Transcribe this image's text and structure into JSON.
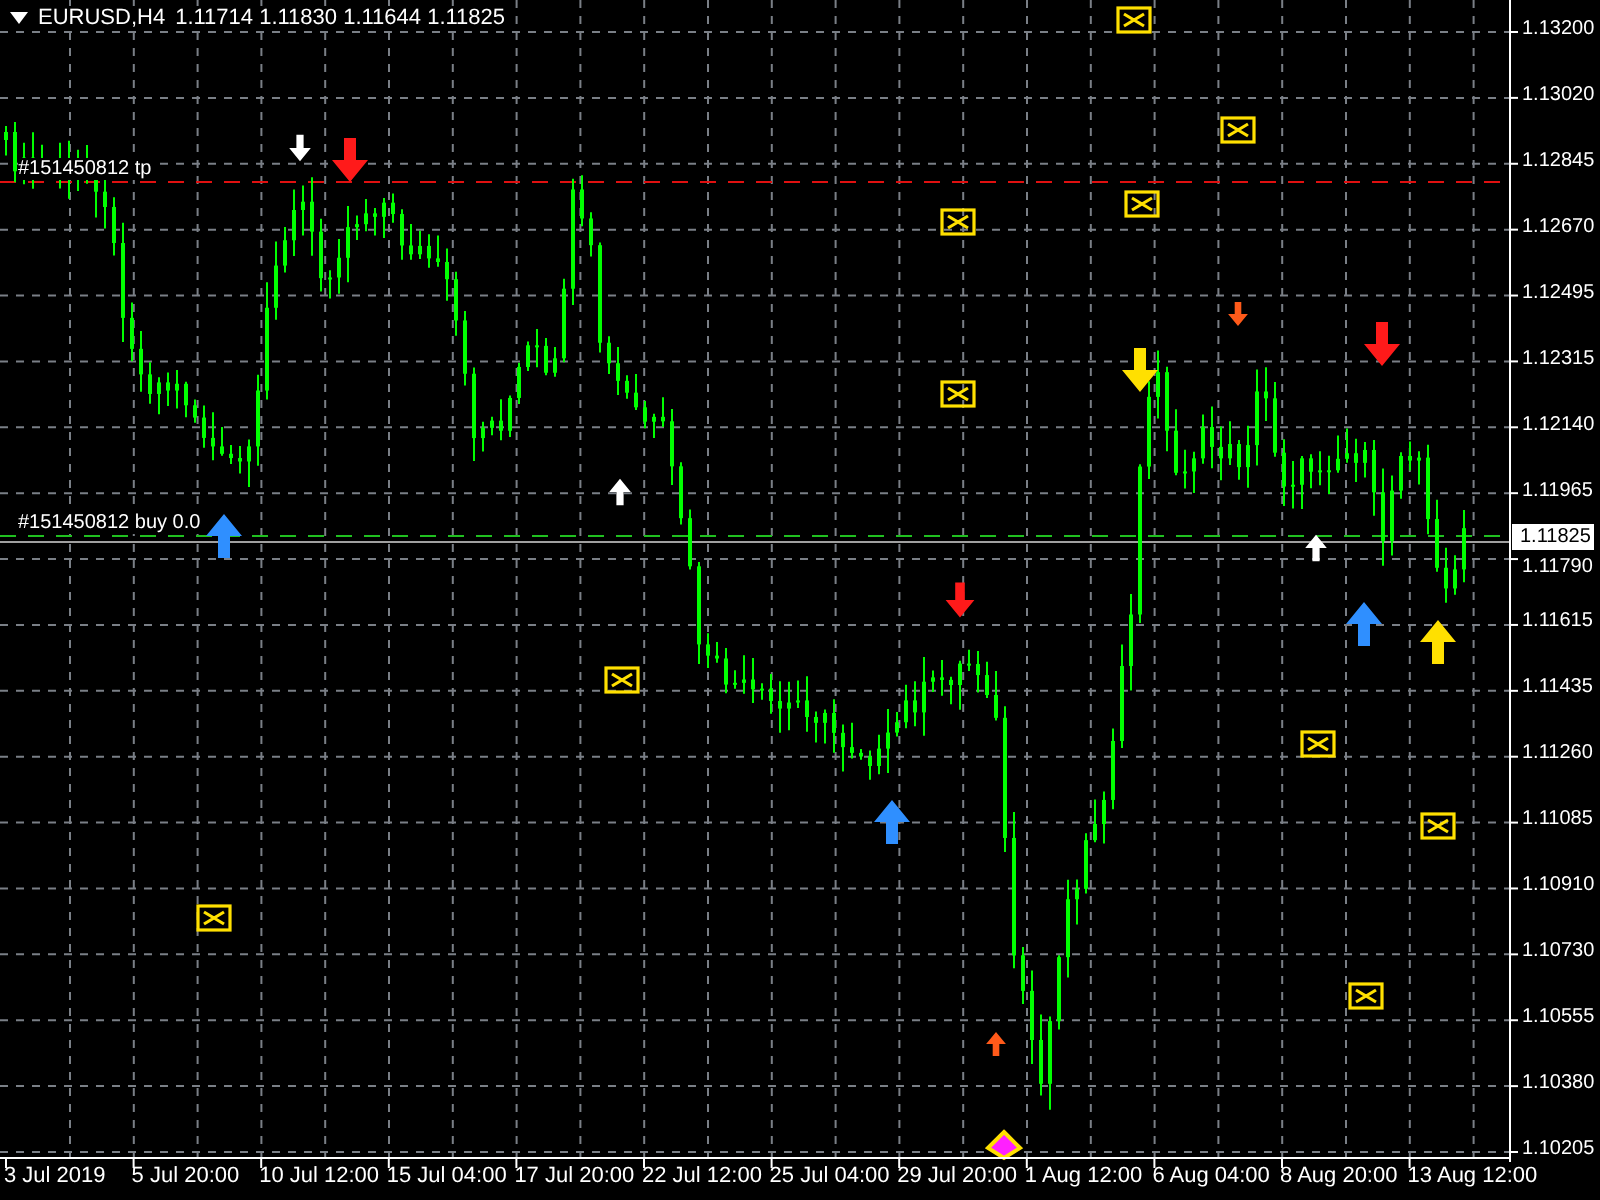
{
  "chart": {
    "symbol": "EURUSD,H4",
    "ohlc": "1.11714 1.11830 1.11644 1.11825",
    "price_labels": [
      "1.13200",
      "1.13020",
      "1.12845",
      "1.12670",
      "1.12495",
      "1.12315",
      "1.12140",
      "1.11965",
      "1.11790",
      "1.11615",
      "1.11435",
      "1.11260",
      "1.11085",
      "1.10910",
      "1.10730",
      "1.10555",
      "1.10380",
      "1.10205"
    ],
    "current_price": "1.11825",
    "time_labels": [
      "3 Jul 2019",
      "5 Jul 20:00",
      "10 Jul 12:00",
      "15 Jul 04:00",
      "17 Jul 20:00",
      "22 Jul 12:00",
      "25 Jul 04:00",
      "29 Jul 20:00",
      "1 Aug 12:00",
      "6 Aug 04:00",
      "8 Aug 20:00",
      "13 Aug 12:00"
    ],
    "order_labels": [
      {
        "kind": "tp",
        "text": "#151450812 tp"
      },
      {
        "kind": "buy",
        "text": "#151450812 buy 0.0"
      }
    ]
  }
}
